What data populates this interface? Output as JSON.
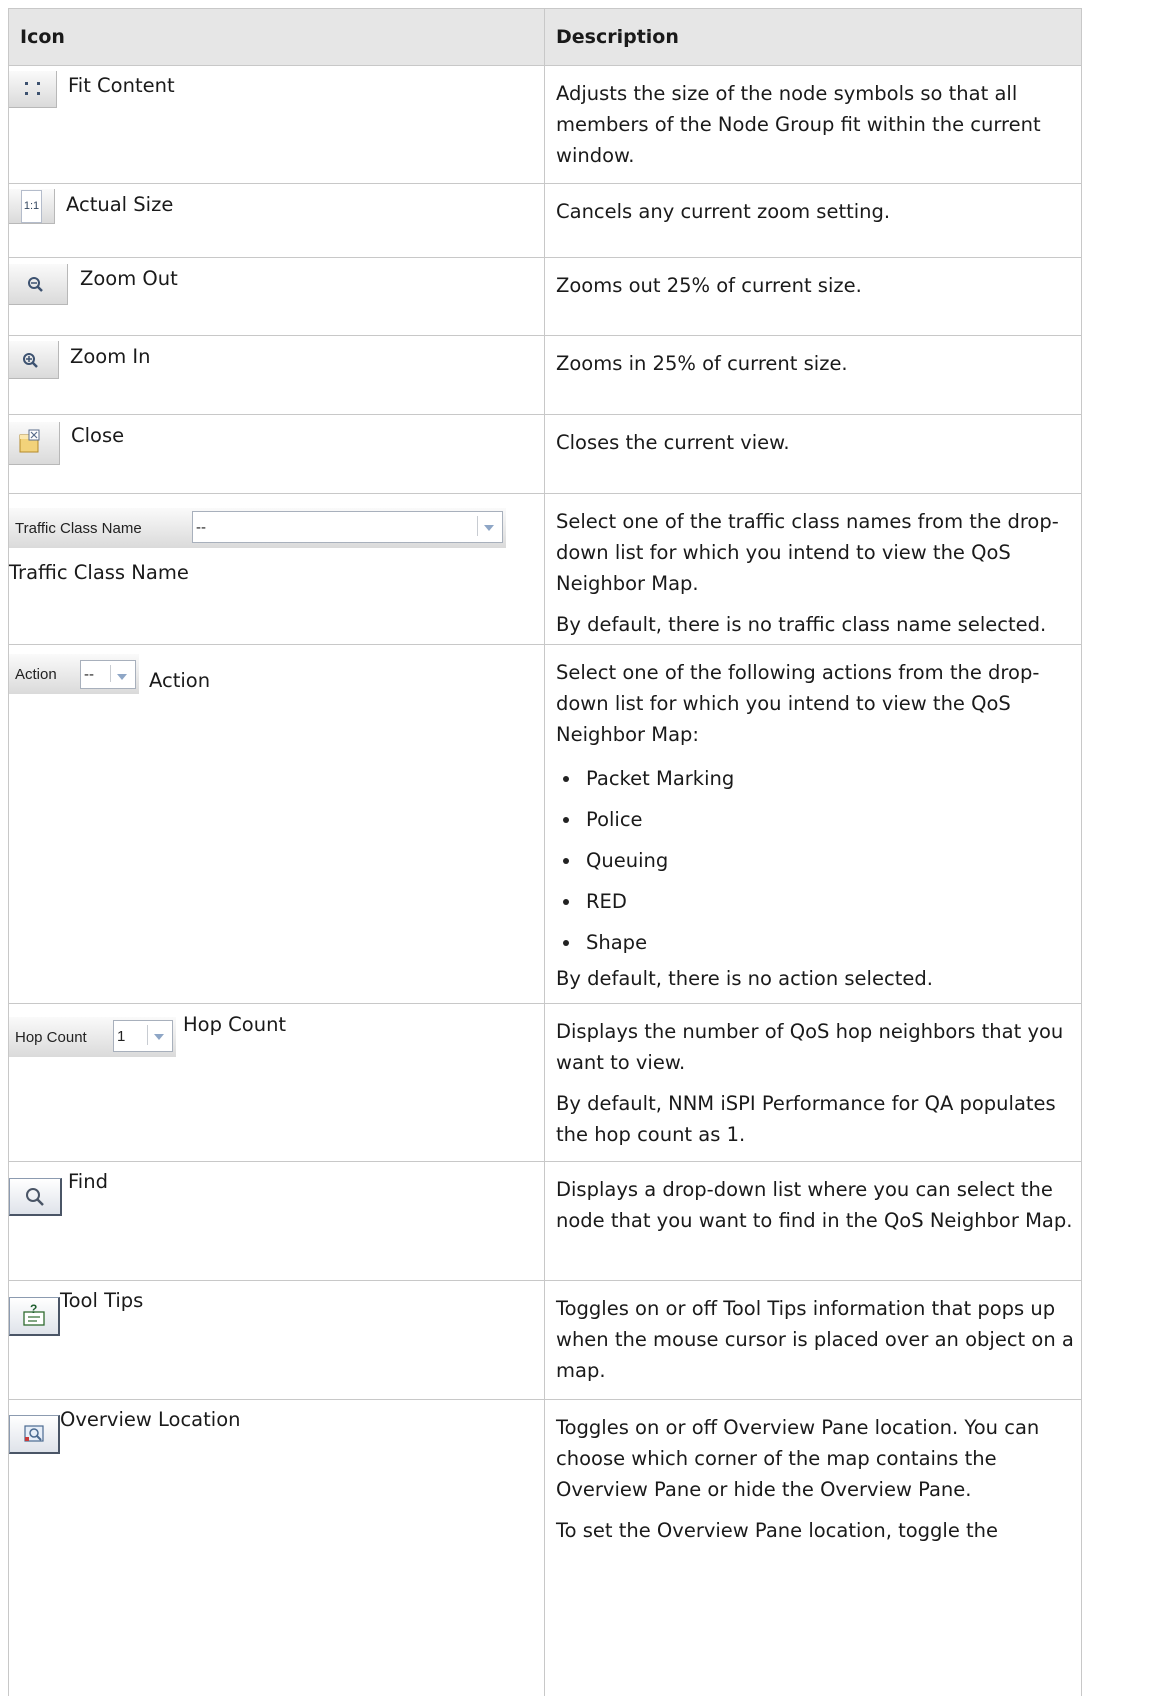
{
  "table": {
    "header": {
      "icon": "Icon",
      "description": "Description"
    },
    "rows": [
      {
        "label": "Fit Content",
        "icon": "fit-content-icon",
        "desc": [
          "Adjusts the size of the node symbols so that all members of the Node Group fit within the current window."
        ]
      },
      {
        "label": "Actual Size",
        "icon": "actual-size-icon",
        "icon_text": "1:1",
        "desc": [
          "Cancels any current zoom setting."
        ]
      },
      {
        "label": "Zoom Out",
        "icon": "zoom-out-icon",
        "desc": [
          "Zooms out 25% of current size."
        ]
      },
      {
        "label": "Zoom In",
        "icon": "zoom-in-icon",
        "desc": [
          "Zooms in 25% of current size."
        ]
      },
      {
        "label": "Close",
        "icon": "close-view-icon",
        "desc": [
          "Closes the current view."
        ]
      },
      {
        "label": "Traffic Class Name",
        "widget_label": "Traffic Class Name",
        "widget_value": "--",
        "desc": [
          "Select one of the traffic class names from the drop-down list for which you intend to view the QoS Neighbor Map.",
          "By default, there is no traffic class name selected."
        ]
      },
      {
        "label": "Action",
        "widget_label": "Action",
        "widget_value": "--",
        "desc_intro": "Select one of the following actions from the drop-down list for which you intend to view the QoS Neighbor Map:",
        "items": [
          "Packet Marking",
          "Police",
          "Queuing",
          "RED",
          "Shape"
        ],
        "desc_outro": "By default, there is no action selected."
      },
      {
        "label": "Hop Count",
        "widget_label": "Hop Count",
        "widget_value": "1",
        "desc": [
          "Displays the number of QoS hop neighbors that you want to view.",
          "By default, NNM iSPI Performance for QA populates the hop count as 1."
        ]
      },
      {
        "label": "Find",
        "icon": "find-icon",
        "desc": [
          "Displays a drop-down list where you can select the node that you want to find in the QoS Neighbor Map."
        ]
      },
      {
        "label": "Tool Tips",
        "icon": "tool-tips-icon",
        "desc": [
          "Toggles on or off Tool Tips information that pops up when the mouse cursor is placed over an object on a map."
        ]
      },
      {
        "label": "Overview Location",
        "icon": "overview-location-icon",
        "desc": [
          "Toggles on or off Overview Pane location. You can choose which corner of the map contains the Overview Pane or hide the Overview Pane.",
          "To set the Overview Pane location, toggle the"
        ]
      }
    ]
  }
}
